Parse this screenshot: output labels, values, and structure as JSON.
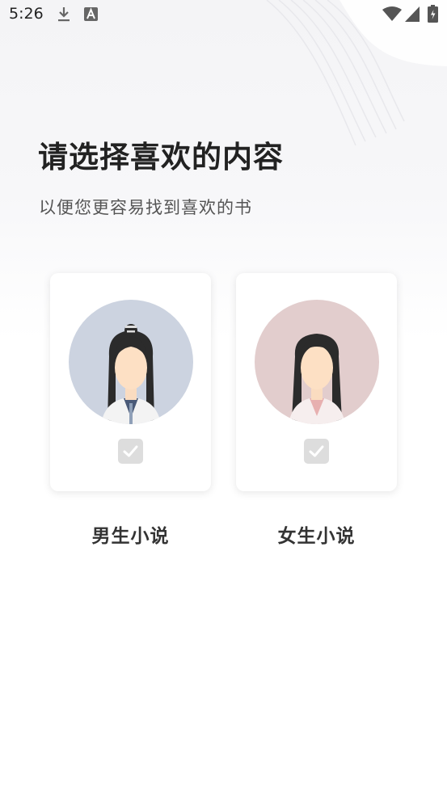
{
  "status_bar": {
    "time": "5:26",
    "left_icons": [
      "download-icon",
      "a-app-icon"
    ],
    "right_icons": [
      "wifi-icon",
      "signal-icon",
      "battery-icon"
    ]
  },
  "header": {
    "title": "请选择喜欢的内容",
    "subtitle": "以便您更容易找到喜欢的书"
  },
  "options": [
    {
      "label": "男生小说",
      "icon": "male-avatar-icon",
      "selected": false,
      "avatar_bg": "#ccd3e0"
    },
    {
      "label": "女生小说",
      "icon": "female-avatar-icon",
      "selected": false,
      "avatar_bg": "#e2cdcd"
    }
  ],
  "colors": {
    "check_bg": "#dddddd",
    "text_primary": "#222222",
    "text_secondary": "#555555"
  }
}
